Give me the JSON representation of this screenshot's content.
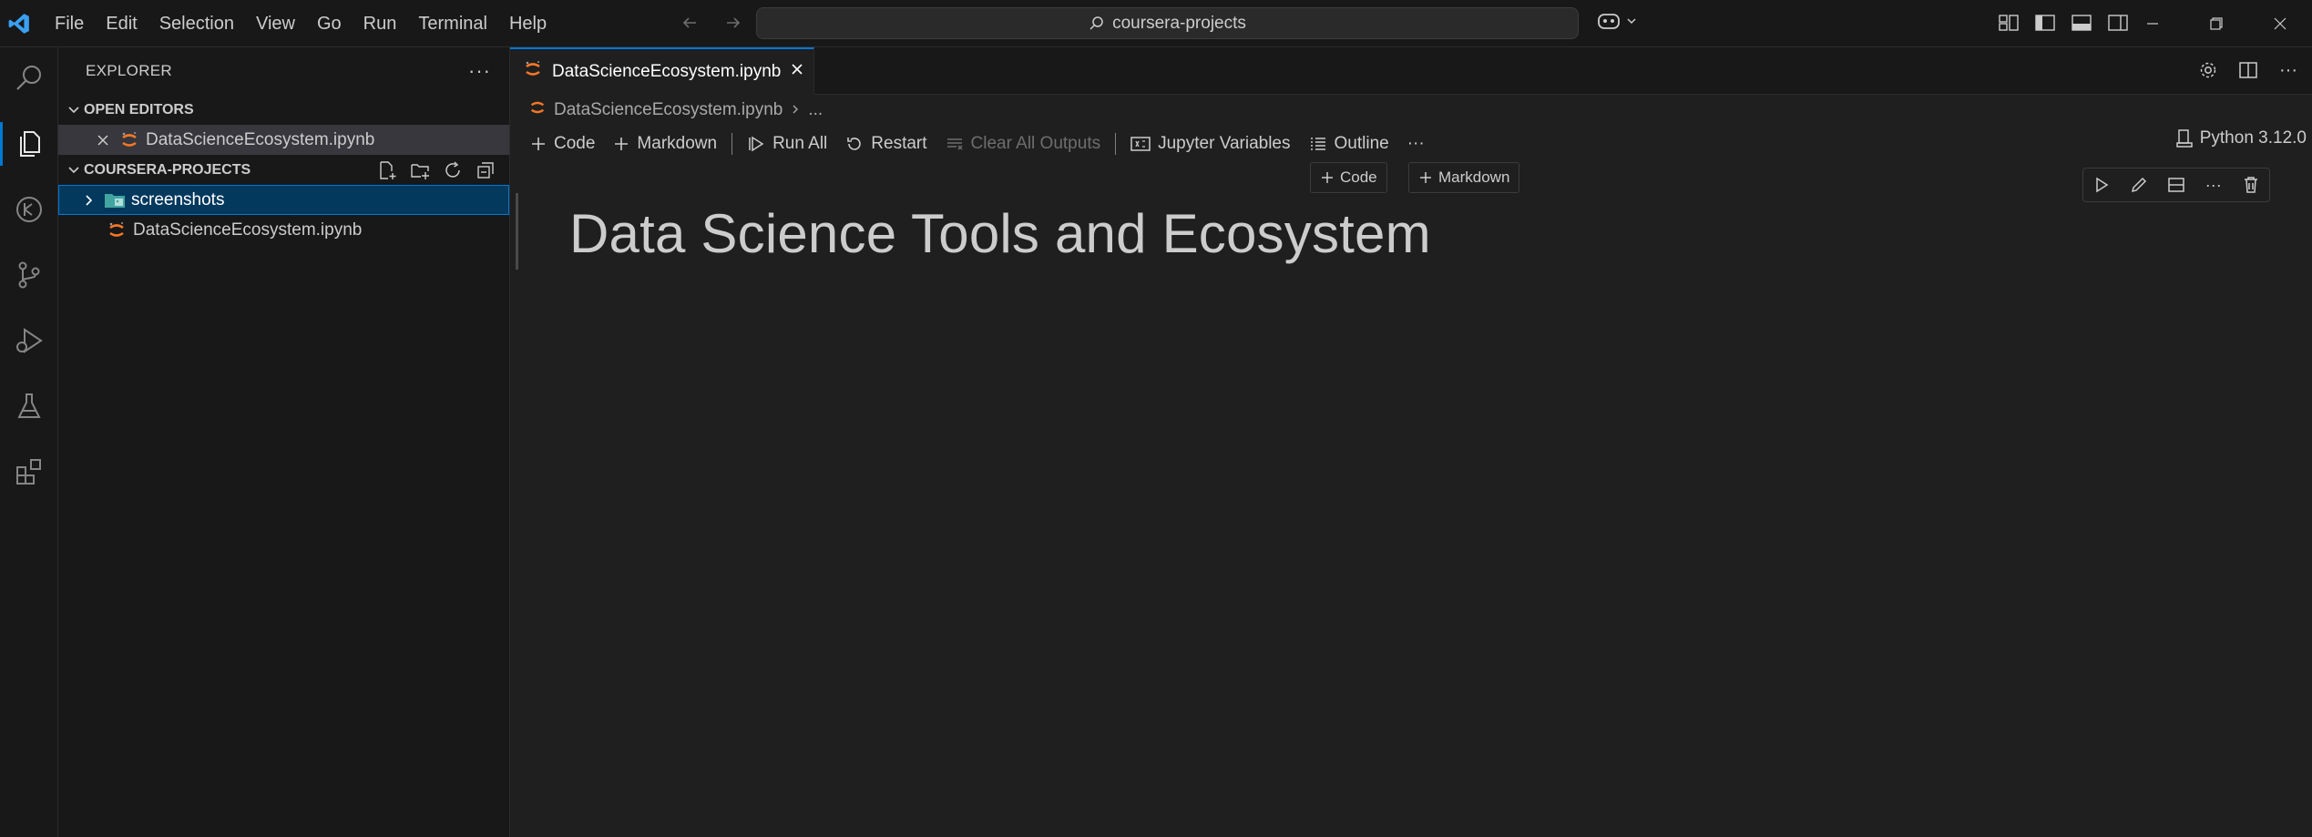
{
  "menu": [
    "File",
    "Edit",
    "Selection",
    "View",
    "Go",
    "Run",
    "Terminal",
    "Help"
  ],
  "command_center": {
    "text": "coursera-projects"
  },
  "sidebar": {
    "title": "EXPLORER",
    "open_editors": {
      "label": "OPEN EDITORS",
      "items": [
        {
          "name": "DataScienceEcosystem.ipynb"
        }
      ]
    },
    "project": {
      "label": "COURSERA-PROJECTS",
      "items": [
        {
          "name": "screenshots",
          "type": "folder"
        },
        {
          "name": "DataScienceEcosystem.ipynb",
          "type": "notebook"
        }
      ]
    }
  },
  "tab": {
    "label": "DataScienceEcosystem.ipynb"
  },
  "breadcrumb": {
    "file": "DataScienceEcosystem.ipynb",
    "more": "..."
  },
  "toolbar": {
    "code": "Code",
    "markdown": "Markdown",
    "run_all": "Run All",
    "restart": "Restart",
    "clear_outputs": "Clear All Outputs",
    "variables": "Jupyter Variables",
    "outline": "Outline",
    "more": "···"
  },
  "kernel": {
    "label": "Python 3.12.0"
  },
  "insert": {
    "code": "Code",
    "markdown": "Markdown"
  },
  "cell": {
    "heading": "Data Science Tools and Ecosystem"
  },
  "colors": {
    "accent": "#0078d4",
    "jupyter": "#f37726",
    "folder": "#42a5a0"
  }
}
